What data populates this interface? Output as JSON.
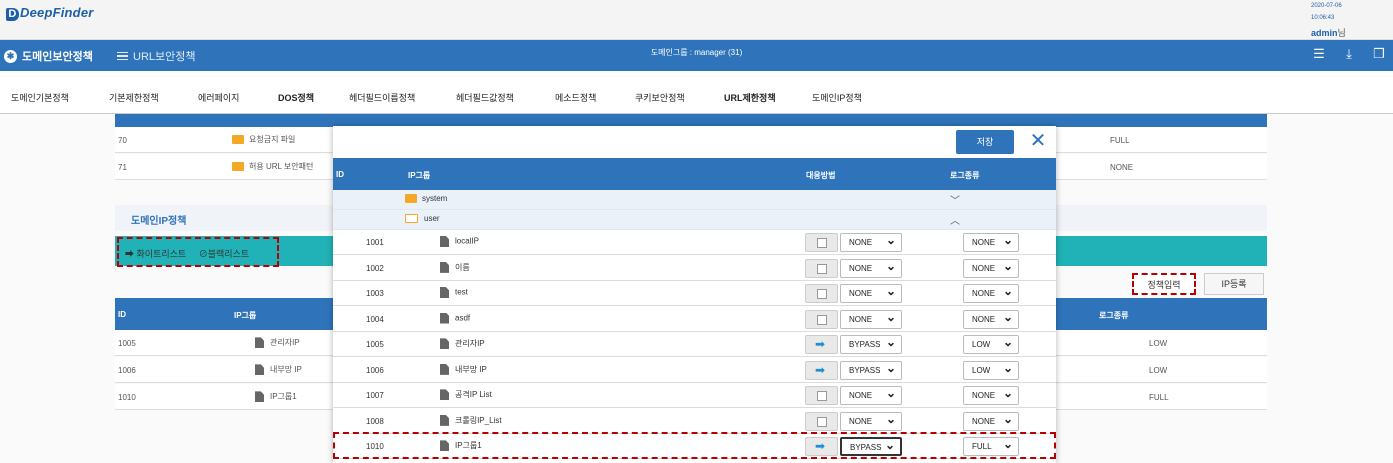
{
  "header": {
    "logo": "DeepFinder",
    "date": "2020-07-06",
    "time": "10:06:43",
    "user": "admin",
    "user_suffix": "님"
  },
  "nav": {
    "title": "도메인보안정책",
    "tab2": "URL보안정책",
    "center": "도메인그룹 : manager (31)",
    "icons": [
      "list-icon",
      "download-icon",
      "copy-icon"
    ]
  },
  "submenu": [
    "도메인기본정책",
    "기본제한정책",
    "에러페이지",
    "DOS정책",
    "헤더필드이름정책",
    "헤더필드값정책",
    "메소드정책",
    "쿠키보안정책",
    "URL제한정책",
    "도메인IP정책"
  ],
  "background": {
    "rows": [
      {
        "id": "70",
        "name": "요청금지 파일",
        "log": "FULL"
      },
      {
        "id": "71",
        "name": "허용 URL 보안패턴",
        "log": "NONE"
      }
    ],
    "section_title": "도메인IP정책",
    "whitelist": "화이트리스트",
    "blacklist": "블랙리스트",
    "policy_btn": "정책입력",
    "ip_btn": "IP등록",
    "head": {
      "id": "ID",
      "group": "IP그룹",
      "log": "로그종류"
    },
    "table": [
      {
        "id": "1005",
        "name": "관리자IP",
        "log": "LOW"
      },
      {
        "id": "1006",
        "name": "내부망 IP",
        "log": "LOW"
      },
      {
        "id": "1010",
        "name": "IP그룹1",
        "log": "FULL"
      }
    ]
  },
  "modal": {
    "save": "저장",
    "head": {
      "id": "ID",
      "group": "IP그룹",
      "action": "대응방법",
      "log": "로그종류"
    },
    "groups": [
      {
        "name": "system",
        "chevron": "﹀"
      },
      {
        "name": "user",
        "chevron": "︿"
      }
    ],
    "rows": [
      {
        "id": "1001",
        "name": "localIP",
        "action": "NONE",
        "log": "NONE",
        "bypass": false
      },
      {
        "id": "1002",
        "name": "이름",
        "action": "NONE",
        "log": "NONE",
        "bypass": false
      },
      {
        "id": "1003",
        "name": "test",
        "action": "NONE",
        "log": "NONE",
        "bypass": false
      },
      {
        "id": "1004",
        "name": "asdf",
        "action": "NONE",
        "log": "NONE",
        "bypass": false
      },
      {
        "id": "1005",
        "name": "관리자IP",
        "action": "BYPASS",
        "log": "LOW",
        "bypass": true
      },
      {
        "id": "1006",
        "name": "내부망 IP",
        "action": "BYPASS",
        "log": "LOW",
        "bypass": true
      },
      {
        "id": "1007",
        "name": "공격IP List",
        "action": "NONE",
        "log": "NONE",
        "bypass": false
      },
      {
        "id": "1008",
        "name": "크롤링IP_List",
        "action": "NONE",
        "log": "NONE",
        "bypass": false
      },
      {
        "id": "1010",
        "name": "IP그룹1",
        "action": "BYPASS",
        "log": "FULL",
        "bypass": true
      }
    ]
  }
}
